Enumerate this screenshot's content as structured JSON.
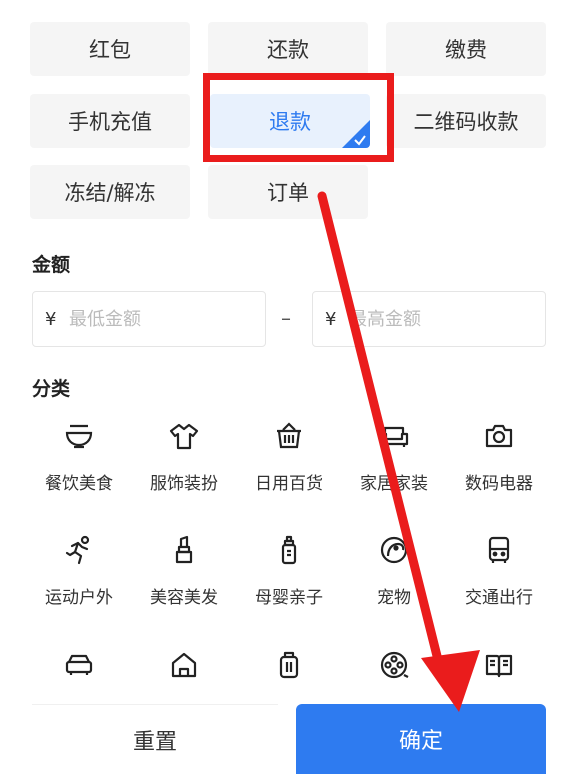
{
  "filter_types": {
    "items": [
      {
        "label": "红包",
        "selected": false
      },
      {
        "label": "还款",
        "selected": false
      },
      {
        "label": "缴费",
        "selected": false
      },
      {
        "label": "手机充值",
        "selected": false
      },
      {
        "label": "退款",
        "selected": true
      },
      {
        "label": "二维码收款",
        "selected": false
      },
      {
        "label": "冻结/解冻",
        "selected": false
      },
      {
        "label": "订单",
        "selected": false
      }
    ]
  },
  "amount": {
    "title": "金额",
    "currency_symbol": "¥",
    "min_placeholder": "最低金额",
    "max_placeholder": "最高金额",
    "separator": "–"
  },
  "category": {
    "title": "分类",
    "items": [
      {
        "label": "餐饮美食",
        "icon": "bowl-icon"
      },
      {
        "label": "服饰装扮",
        "icon": "shirt-icon"
      },
      {
        "label": "日用百货",
        "icon": "basket-icon"
      },
      {
        "label": "家居家装",
        "icon": "sofa-icon"
      },
      {
        "label": "数码电器",
        "icon": "camera-icon"
      },
      {
        "label": "运动户外",
        "icon": "runner-icon"
      },
      {
        "label": "美容美发",
        "icon": "lipstick-icon"
      },
      {
        "label": "母婴亲子",
        "icon": "baby-bottle-icon"
      },
      {
        "label": "宠物",
        "icon": "pet-icon"
      },
      {
        "label": "交通出行",
        "icon": "bus-icon"
      },
      {
        "icon": "car-icon"
      },
      {
        "icon": "house-icon"
      },
      {
        "icon": "luggage-icon"
      },
      {
        "icon": "film-reel-icon"
      },
      {
        "icon": "book-icon"
      }
    ]
  },
  "actions": {
    "reset_label": "重置",
    "confirm_label": "确定"
  },
  "colors": {
    "accent": "#2e7bf0",
    "annotation_red": "#ea1c1c",
    "chip_bg": "#f5f5f5"
  }
}
